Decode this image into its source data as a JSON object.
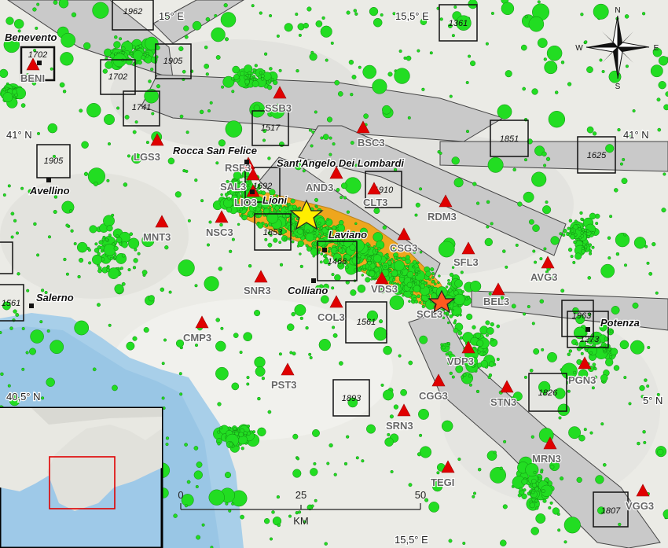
{
  "colors": {
    "background": "#e9e9e4",
    "sea": "#9ec9e8",
    "fault_zone": "#c9c9c9",
    "epicenters": "#22dd22",
    "rupture_zone": "#f5a100",
    "station": "#e00000",
    "mainshock_star": "#ffee00",
    "secondary_star": "#ff5a1f",
    "inset_box": "#e00000"
  },
  "grid_labels": [
    {
      "id": "lon15-top",
      "text": "15° E"
    },
    {
      "id": "lon155-top",
      "text": "15,5° E"
    },
    {
      "id": "lat41-left",
      "text": "41° N"
    },
    {
      "id": "lat41-right",
      "text": "41° N"
    },
    {
      "id": "lat405-left",
      "text": "40,5° N"
    },
    {
      "id": "lat405-right",
      "text": "5° N"
    },
    {
      "id": "lon155-bottom",
      "text": "15,5° E"
    }
  ],
  "towns": [
    {
      "id": "benevento",
      "name": "Benevento"
    },
    {
      "id": "rocca",
      "name": "Rocca San Felice"
    },
    {
      "id": "santangelo",
      "name": "Sant'Angelo Dei Lombardi"
    },
    {
      "id": "avellino",
      "name": "Avellino"
    },
    {
      "id": "lioni",
      "name": "Lioni"
    },
    {
      "id": "laviano",
      "name": "Laviano"
    },
    {
      "id": "colliano",
      "name": "Colliano"
    },
    {
      "id": "salerno",
      "name": "Salerno"
    },
    {
      "id": "potenza",
      "name": "Potenza"
    }
  ],
  "stations": [
    {
      "id": "BENI",
      "label": "BENI"
    },
    {
      "id": "SSB3",
      "label": "SSB3"
    },
    {
      "id": "BSC3",
      "label": "BSC3"
    },
    {
      "id": "LGS3",
      "label": "LGS3"
    },
    {
      "id": "RSF3",
      "label": "RSF3"
    },
    {
      "id": "SAL3",
      "label": "SAL3"
    },
    {
      "id": "LIO3",
      "label": "LIO3"
    },
    {
      "id": "AND3",
      "label": "AND3"
    },
    {
      "id": "CLT3",
      "label": "CLT3"
    },
    {
      "id": "RDM3",
      "label": "RDM3"
    },
    {
      "id": "MNT3",
      "label": "MNT3"
    },
    {
      "id": "NSC3",
      "label": "NSC3"
    },
    {
      "id": "CSG3",
      "label": "CSG3"
    },
    {
      "id": "SFL3",
      "label": "SFL3"
    },
    {
      "id": "AVG3",
      "label": "AVG3"
    },
    {
      "id": "SNR3",
      "label": "SNR3"
    },
    {
      "id": "VDS3",
      "label": "VDS3"
    },
    {
      "id": "COL3",
      "label": "COL3"
    },
    {
      "id": "SCL3",
      "label": "SCL3"
    },
    {
      "id": "BEL3",
      "label": "BEL3"
    },
    {
      "id": "CMP3",
      "label": "CMP3"
    },
    {
      "id": "VDP3",
      "label": "VDP3"
    },
    {
      "id": "PGN3",
      "label": "PGN3"
    },
    {
      "id": "PST3",
      "label": "PST3"
    },
    {
      "id": "CGG3",
      "label": "CGG3"
    },
    {
      "id": "STN3",
      "label": "STN3"
    },
    {
      "id": "SRN3",
      "label": "SRN3"
    },
    {
      "id": "MRN3",
      "label": "MRN3"
    },
    {
      "id": "TEGI",
      "label": "TEGI"
    },
    {
      "id": "VGG3",
      "label": "VGG3"
    }
  ],
  "historical_events": [
    {
      "id": "h1962",
      "year": "1962"
    },
    {
      "id": "h1702",
      "year": "1702"
    },
    {
      "id": "h1905a",
      "year": "1905"
    },
    {
      "id": "h1702b",
      "year": "1702"
    },
    {
      "id": "h1741",
      "year": "1741"
    },
    {
      "id": "h1361",
      "year": "1361"
    },
    {
      "id": "h1517",
      "year": "1517"
    },
    {
      "id": "h1851",
      "year": "1851"
    },
    {
      "id": "h1625",
      "year": "1625"
    },
    {
      "id": "h1905b",
      "year": "1905"
    },
    {
      "id": "h1692",
      "year": "1692"
    },
    {
      "id": "h1910",
      "year": "1910"
    },
    {
      "id": "h1853",
      "year": "1853"
    },
    {
      "id": "h1466",
      "year": "1466"
    },
    {
      "id": "h1561a",
      "year": "1561"
    },
    {
      "id": "h1561b",
      "year": "1561"
    },
    {
      "id": "h1963",
      "year": "1963"
    },
    {
      "id": "h1273",
      "year": "1273"
    },
    {
      "id": "h1893",
      "year": "1893"
    },
    {
      "id": "h1826",
      "year": "1826"
    },
    {
      "id": "h1807",
      "year": "1807"
    }
  ],
  "scale_bar": {
    "ticks": [
      "0",
      "25",
      "50"
    ],
    "unit": "KM"
  },
  "compass": {
    "n": "N",
    "s": "S",
    "e": "E",
    "w": "W"
  }
}
